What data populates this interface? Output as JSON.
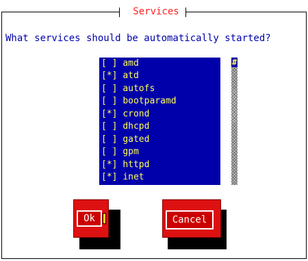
{
  "dialog": {
    "title": "Services",
    "prompt": "What services should be automatically started?"
  },
  "services": [
    {
      "mark": "[ ]",
      "name": "amd"
    },
    {
      "mark": "[*]",
      "name": "atd"
    },
    {
      "mark": "[ ]",
      "name": "autofs"
    },
    {
      "mark": "[ ]",
      "name": "bootparamd"
    },
    {
      "mark": "[*]",
      "name": "crond"
    },
    {
      "mark": "[ ]",
      "name": "dhcpd"
    },
    {
      "mark": "[ ]",
      "name": "gated"
    },
    {
      "mark": "[ ]",
      "name": "gpm"
    },
    {
      "mark": "[*]",
      "name": "httpd"
    },
    {
      "mark": "[*]",
      "name": "inet"
    }
  ],
  "scrollbar": {
    "thumb_glyph": "#"
  },
  "buttons": {
    "ok_label": "Ok",
    "cancel_label": "Cancel"
  },
  "colors": {
    "list_background": "#0000aa",
    "list_text": "#ffff55",
    "title_text": "#ff2020",
    "prompt_text": "#0000aa",
    "button_face": "#cc0000",
    "button_text": "#ffffff",
    "focus_cursor": "#ffff00"
  }
}
